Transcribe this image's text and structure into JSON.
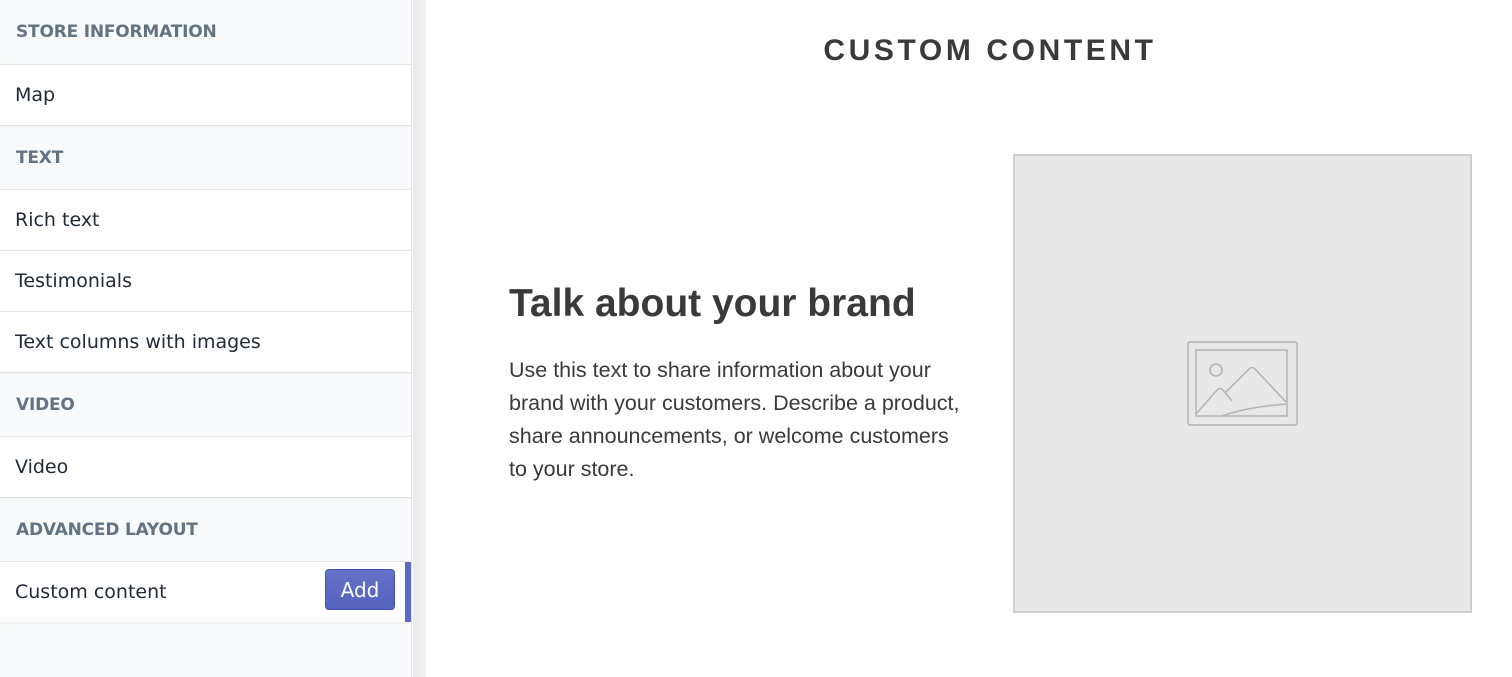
{
  "sidebar": {
    "sections": [
      {
        "header": "STORE INFORMATION",
        "items": [
          {
            "label": "Map"
          }
        ]
      },
      {
        "header": "TEXT",
        "items": [
          {
            "label": "Rich text"
          },
          {
            "label": "Testimonials"
          },
          {
            "label": "Text columns with images"
          }
        ]
      },
      {
        "header": "VIDEO",
        "items": [
          {
            "label": "Video"
          }
        ]
      },
      {
        "header": "ADVANCED LAYOUT",
        "items": [
          {
            "label": "Custom content",
            "active": true,
            "button": "Add"
          }
        ]
      }
    ]
  },
  "preview": {
    "title": "CUSTOM CONTENT",
    "heading": "Talk about your brand",
    "body": "Use this text to share information about your brand with your customers. Describe a product, share announcements, or welcome customers to your store.",
    "image_icon": "image-placeholder-icon"
  },
  "colors": {
    "accent": "#5c6ac4",
    "section_header_text": "#637381",
    "preview_text": "#3a3a3a",
    "placeholder_bg": "#e8e8e8"
  }
}
